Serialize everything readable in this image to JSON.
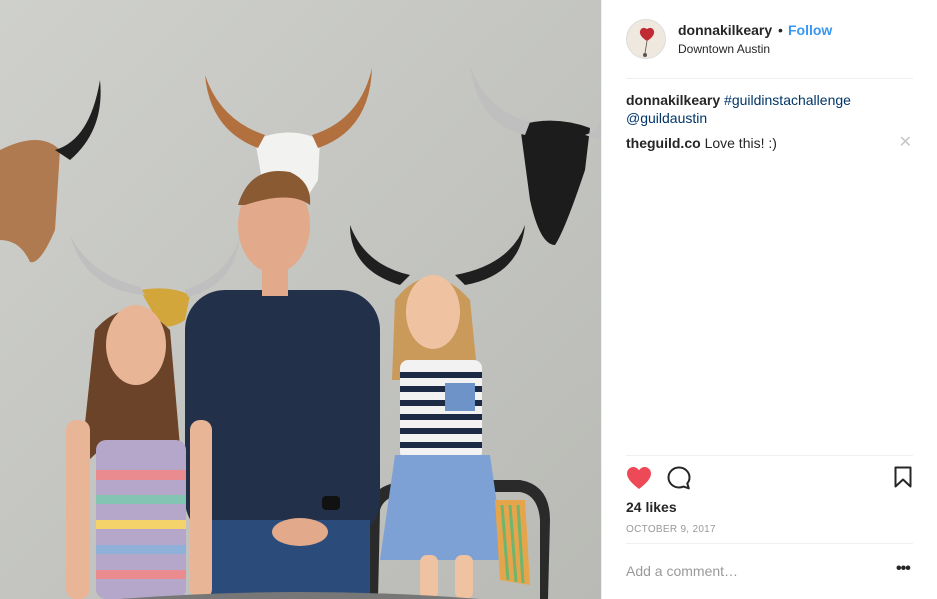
{
  "post": {
    "username": "donnakilkeary",
    "separator": "•",
    "follow_label": "Follow",
    "location": "Downtown Austin"
  },
  "caption": {
    "username": "donnakilkeary",
    "hashtag": "#guildinstachallenge",
    "mention": "@guildaustin"
  },
  "comments": [
    {
      "username": "theguild.co",
      "text": "Love this! :)"
    }
  ],
  "close_glyph": "✕",
  "actions": {
    "like_icon": "heart-icon",
    "comment_icon": "comment-bubble-icon",
    "save_icon": "bookmark-icon"
  },
  "likes_label": "24 likes",
  "date": "OCTOBER 9, 2017",
  "add_comment_placeholder": "Add a comment…",
  "more_glyph": "•••",
  "colors": {
    "follow": "#3897f0",
    "like_red": "#ed4956",
    "hashtag": "#003569",
    "muted": "#999999"
  }
}
